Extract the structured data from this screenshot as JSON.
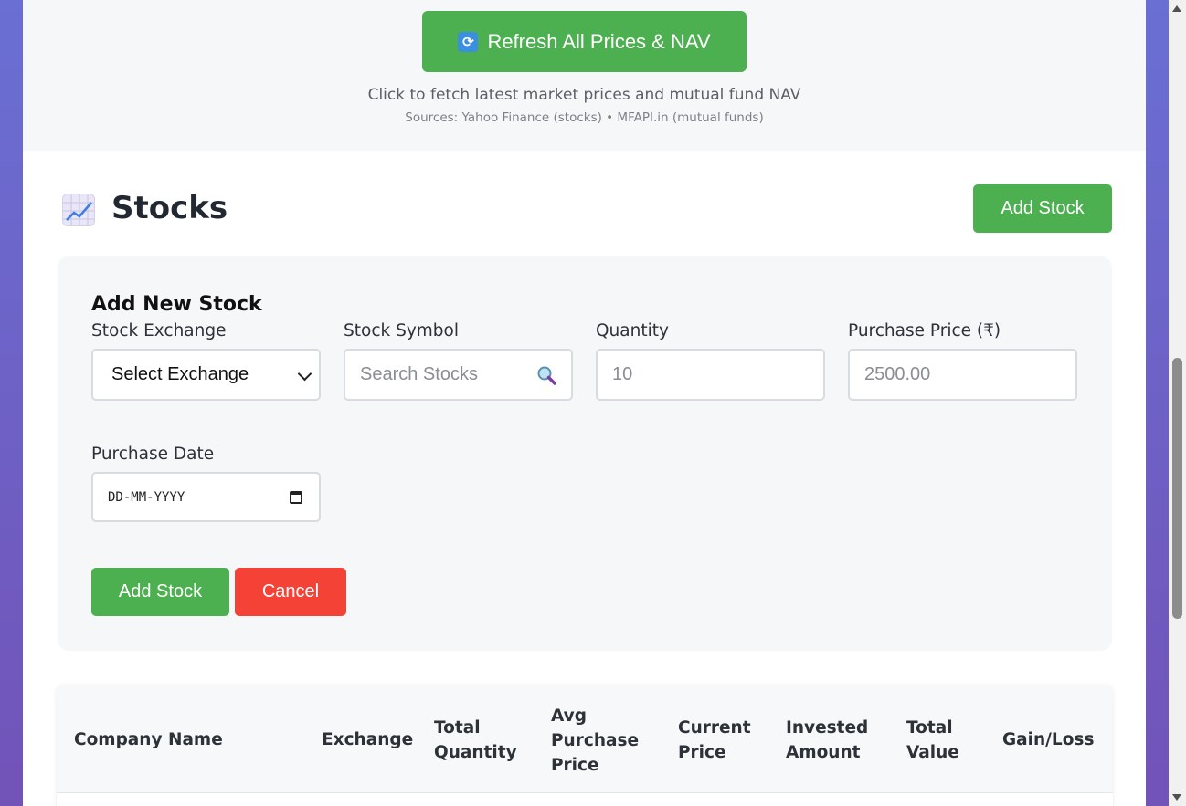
{
  "refresh": {
    "button_label": "Refresh All Prices & NAV",
    "hint": "Click to fetch latest market prices and mutual fund NAV",
    "sources": "Sources: Yahoo Finance (stocks) • MFAPI.in (mutual funds)"
  },
  "stocks_section": {
    "title": "Stocks",
    "add_button_label": "Add Stock"
  },
  "form": {
    "heading": "Add New Stock",
    "exchange": {
      "label": "Stock Exchange",
      "selected": "Select Exchange"
    },
    "symbol": {
      "label": "Stock Symbol",
      "placeholder": "Search Stocks"
    },
    "quantity": {
      "label": "Quantity",
      "placeholder": "10"
    },
    "price": {
      "label": "Purchase Price (₹)",
      "placeholder": "2500.00"
    },
    "date": {
      "label": "Purchase Date",
      "placeholder": "DD-MM-YYYY"
    },
    "submit_label": "Add Stock",
    "cancel_label": "Cancel"
  },
  "table": {
    "headers": [
      {
        "lines": [
          "Company Name"
        ]
      },
      {
        "lines": [
          "Exchange"
        ]
      },
      {
        "lines": [
          "Total",
          "Quantity"
        ]
      },
      {
        "lines": [
          "Avg",
          "Purchase",
          "Price"
        ]
      },
      {
        "lines": [
          "Current",
          "Price"
        ]
      },
      {
        "lines": [
          "Invested",
          "Amount"
        ]
      },
      {
        "lines": [
          "Total",
          "Value"
        ]
      },
      {
        "lines": [
          "Gain/Loss"
        ]
      }
    ]
  },
  "colors": {
    "primary_green": "#4caf50",
    "danger_red": "#f44336",
    "background_gradient": "#6a6fd3"
  },
  "icons": {
    "refresh": "refresh-icon",
    "section": "chart-increasing-icon",
    "search": "magnifier-icon",
    "calendar": "calendar-icon",
    "dropdown": "chevron-down-icon"
  }
}
